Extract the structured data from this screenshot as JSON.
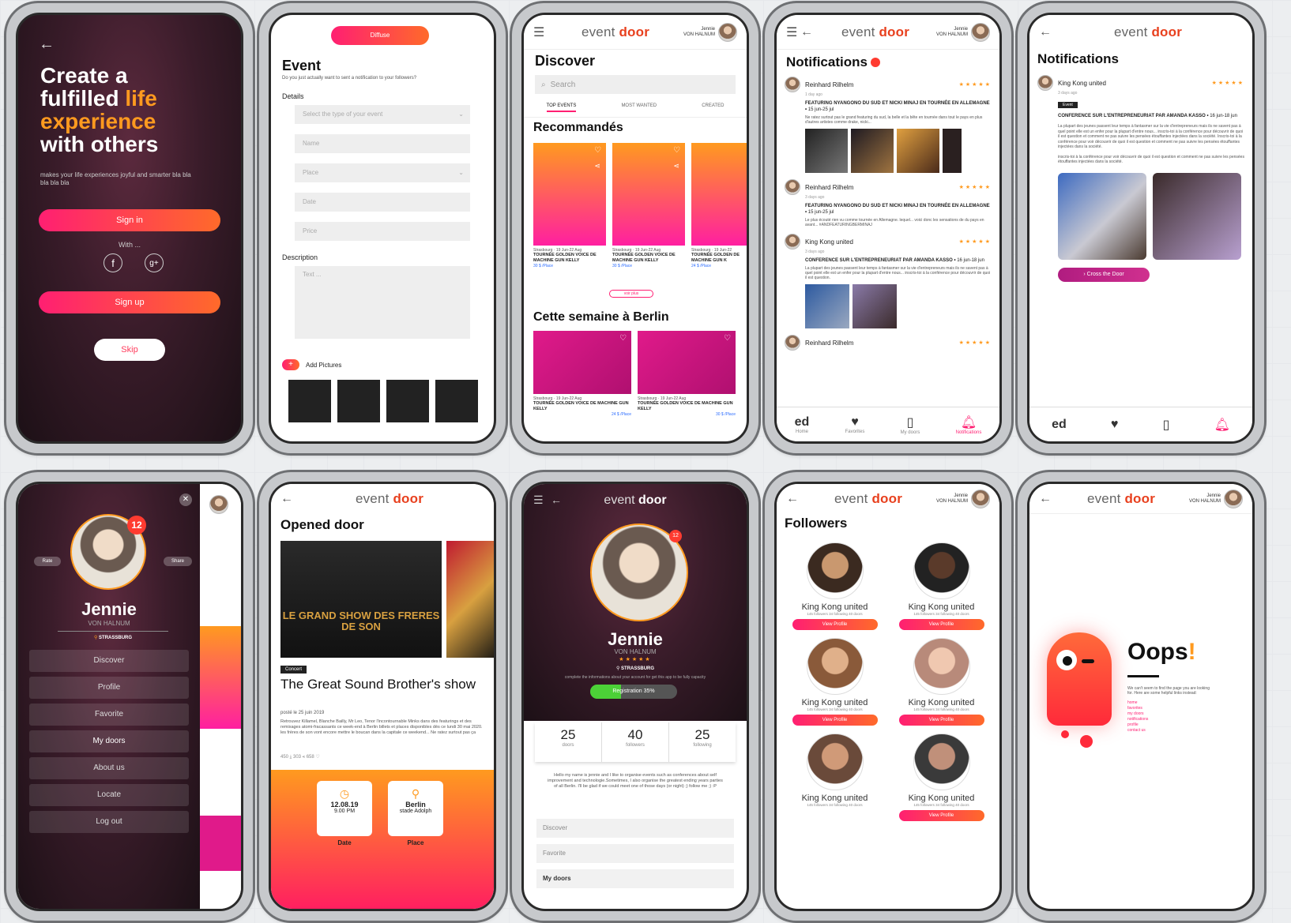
{
  "brand": {
    "name_light": "event",
    "name_bold": "door",
    "user_line1": "Jennie",
    "user_line2": "VON HALNUM"
  },
  "colors": {
    "accent_pink": "#ff1f72",
    "accent_orange": "#ff6a2a",
    "dark_bg": "#3a1c2a",
    "oops_red": "#ff3b30"
  },
  "splash": {
    "title_l1": "Create a",
    "title_l2a": "fulfilled ",
    "title_l2b": "life",
    "title_l3": "experience",
    "title_l4": "with others",
    "subtitle": "makes your life experiences joyful and smarter bla bla bla bla bla",
    "signin": "Sign in",
    "with": "With ...",
    "signup": "Sign up",
    "skip": "Skip"
  },
  "create_event": {
    "top_btn": "Diffuse",
    "title": "Event",
    "subtitle": "Do you just actually want to sent a notification to your followers?",
    "details": "Details",
    "type_placeholder": "Select the type of your event",
    "name": "Name",
    "place": "Place",
    "date": "Date",
    "price": "Price",
    "description": "Description",
    "text_placeholder": "Text ...",
    "add_pictures": "Add Pictures"
  },
  "discover": {
    "title": "Discover",
    "search": "Search",
    "tabs": [
      "TOP EVENTS",
      "MOST WANTED",
      "CREATED"
    ],
    "section1": "Recommandés",
    "section2": "Cette semaine à Berlin",
    "see_more": "voir plus",
    "cards": [
      {
        "meta": "Strasbourg · 19 Jun-22 Aug",
        "title": "TOURNÉE GOLDEN VOICE DE MACHINE GUN KELLY",
        "price": "30 $ /Place"
      },
      {
        "meta": "Strasbourg · 19 Jun-22 Aug",
        "title": "TOURNÉE GOLDEN VOICE DE MACHINE GUN KELLY",
        "price": "30 $ /Place"
      },
      {
        "meta": "Strasbourg · 19 Jun-22",
        "title": "TOURNÉE GOLDEN DE MACHINE GUN K",
        "price": "24 $ /Place"
      }
    ],
    "cards2": [
      {
        "meta": "Strasbourg · 19 Jun-22 Aug",
        "title": "TOURNÉE GOLDEN VOICE DE MACHINE GUN KELLY",
        "price": "24 $ /Place"
      },
      {
        "meta": "Strasbourg · 19 Jun-22 Aug",
        "title": "TOURNÉE GOLDEN VOICE DE MACHINE GUN KELLY",
        "price": "30 $ /Place"
      }
    ]
  },
  "notifications": {
    "title": "Notifications",
    "badge": "●",
    "items": [
      {
        "author": "Reinhard Rilhelm",
        "time": "1 day ago",
        "headline": "FEATURING NYANGONO DU SUD ET NICKI MINAJ EN TOURNÉE EN ALLEMAGNE",
        "date": "15 jun-25 jul",
        "body": "Ne ratez surtout pas le grand featuring du sud, la belle et la bête en tournée dans tout le pays en plus d'autres artistes comme drake, nicki..."
      },
      {
        "author": "Reinhard Rilhelm",
        "time": "3 days ago",
        "headline": "FEATURING NYANGONO DU SUD ET NICKI MINAJ EN TOURNÉE EN ALLEMAGNE",
        "date": "15 jun-25 jul",
        "body": "Le plus écouté rien vu comme tournée en Allemagne. lequel... voici donc les sensations de du pays en avant... #ANDFEATURINGBERMINAJ"
      },
      {
        "author": "King Kong united",
        "time": "3 days ago",
        "headline": "CONFERENCE SUR L'ENTREPRENEURIAT PAR AMANDA KASSO",
        "date": "16 jun-18 jun",
        "body": "La plupart des jeunes passent leur temps à fantasmer sur la vie d'entrepreneurs mais ils ne savent pas à quel point elle est un enfer pour la plupart d'entre nous... inscris-toi à la conférence pour découvrir de quoi il est question."
      },
      {
        "author": "Reinhard Rilhelm",
        "time": "",
        "headline": "",
        "date": "",
        "body": ""
      }
    ],
    "tabs": [
      "Home",
      "Favorites",
      "My doors",
      "Notifications"
    ]
  },
  "notif_detail": {
    "author": "King Kong united",
    "time": "3 days ago",
    "tag": "Event",
    "headline": "CONFERENCE SUR L'ENTREPRENEURIAT PAR AMANDA KASSO",
    "date": "16 jun-18 jun",
    "body": "La plupart des jeunes passent leur temps à fantasmer sur la vie d'entrepreneurs mais ils ne savent pas à quel point elle est un enfer pour la plupart d'entre nous... inscris-toi à la conférence pour découvrir de quoi il est question et comment ne pas suivre les pensées étouffantes injectées dans la société. Inscris-toi à la conférence pour voir découvrir de quoi il est question et comment ne pas suivre les pensées étouffantes injectées dans la société.",
    "body2": "inscris-toi à la conférence pour voir découvrir de quoi il est question et comment ne pas suivre les pensées étouffantes injectées dans la société.",
    "cta": "Cross the Door"
  },
  "side_menu": {
    "badge": "12",
    "rate": "Rate",
    "share": "Share",
    "name": "Jennie",
    "surname": "VON HALNUM",
    "city": "STRASSBURG",
    "items": [
      "Discover",
      "Profile",
      "Favorite",
      "My doors",
      "About us",
      "Locate",
      "Log out"
    ]
  },
  "opened_door": {
    "title": "Opened door",
    "poster_text": "LE GRAND SHOW DES FRERES DE SON",
    "tag": "Concert",
    "event_title": "The Great  Sound Brother's show",
    "posted": "posté le 25 juin 2019",
    "body": "Retrouvez Killamel, Blanche Bailly, Mr Leo, Tenor l'incontournable Minks dans des featurings et des remixages atomi-fracassants ce week-end à Berlin billets et places disponibles dès ce lundi 30 mai 2020. les frères de son vont encore mettre le boucan dans la capitale ce weekend... Ne ratez surtout pas ça",
    "stats": "450 ⤓   303 ⪪   658 ♡",
    "date_value": "12.08.19",
    "time_value": "9.00 PM",
    "date_label": "Date",
    "place_value": "Berlin",
    "place_sub": "stade Adolph",
    "place_label": "Place"
  },
  "profile": {
    "name": "Jennie",
    "surname": "VON HALNUM",
    "city": "STRASSBURG",
    "badge": "12",
    "note": "complete the informations about your account for get this app to be fully capacity",
    "progress_label": "Registration 35%",
    "progress": 0.35,
    "stats": [
      {
        "num": "25",
        "label": "doors"
      },
      {
        "num": "40",
        "label": "followers"
      },
      {
        "num": "25",
        "label": "following"
      }
    ],
    "bio": "Hello my name is jennie and I like to organise events such as conferences about self improvement and technologie.Sometimes, I also organise the greatest ending years parties of all Berlin. I'll be glad if we could meet one of those days (or night) ;) follow me ;) :P",
    "menu": [
      "Discover",
      "Favorite",
      "My doors"
    ]
  },
  "followers": {
    "title": "Followers",
    "items": [
      {
        "name": "King Kong united",
        "meta": "145 followers   34 following   40 doors",
        "btn": "View Profile"
      },
      {
        "name": "King Kong united",
        "meta": "145 followers   34 following   40 doors",
        "btn": "View Profile"
      },
      {
        "name": "King Kong united",
        "meta": "145 followers   34 following   40 doors",
        "btn": "View Profile"
      },
      {
        "name": "King Kong united",
        "meta": "145 followers   34 following   40 doors",
        "btn": "View Profile"
      },
      {
        "name": "King Kong united",
        "meta": "145 followers   34 following   40 doors",
        "btn": "View Profile"
      },
      {
        "name": "King Kong united",
        "meta": "145 followers   34 following   40 doors",
        "btn": "View Profile"
      }
    ]
  },
  "oops": {
    "title": "Oops",
    "bang": "!",
    "body": "We can't seem to find the page you are looking for. Here are some helpful links instead:",
    "links": [
      "home",
      "favorites",
      "my doors",
      "notifications",
      "profile",
      "contact us"
    ]
  }
}
